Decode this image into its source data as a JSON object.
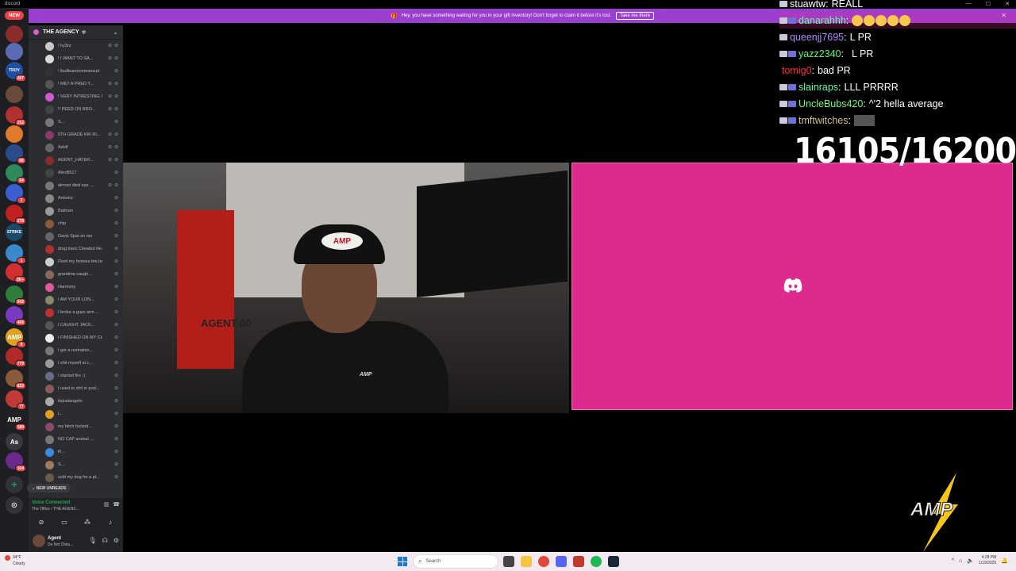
{
  "app": {
    "name": "discord"
  },
  "window_controls": {
    "minimize": "—",
    "maximize": "☐",
    "close": "✕"
  },
  "banner": {
    "text": "Hey, you have something waiting for you in your gift inventory! Don't forget to claim it before it's lost.",
    "button": "Take me there",
    "close": "✕"
  },
  "server_rail": {
    "new_label": "NEW",
    "servers": [
      {
        "badge": "",
        "color": "#8a2c2c",
        "label": ""
      },
      {
        "badge": "",
        "color": "#5b6bb5",
        "label": ""
      },
      {
        "badge": "287",
        "color": "#1d4fa3",
        "label": "TROY"
      },
      {
        "badge": "",
        "color": "#6a4a3a",
        "label": ""
      },
      {
        "badge": "152",
        "color": "#b23030",
        "label": ""
      },
      {
        "badge": "",
        "color": "#e07a2a",
        "label": ""
      },
      {
        "badge": "68",
        "color": "#2a4c8a",
        "label": ""
      },
      {
        "badge": "84",
        "color": "#2e8a5a",
        "label": ""
      },
      {
        "badge": "2",
        "color": "#3a5fd0",
        "label": ""
      },
      {
        "badge": "278",
        "color": "#c02020",
        "label": ""
      },
      {
        "badge": "",
        "color": "#1a4a6a",
        "label": "STRIKE"
      },
      {
        "badge": "1",
        "color": "#3a8acb",
        "label": ""
      },
      {
        "badge": "2K+",
        "color": "#d03030",
        "label": ""
      },
      {
        "badge": "942",
        "color": "#2e7d3a",
        "label": ""
      },
      {
        "badge": "466",
        "color": "#7a3ac0",
        "label": ""
      },
      {
        "badge": "8",
        "color": "#e0a020",
        "label": "AMP"
      },
      {
        "badge": "779",
        "color": "#b02a2a",
        "label": ""
      },
      {
        "badge": "822",
        "color": "#8a5a3a",
        "label": ""
      },
      {
        "badge": "77",
        "color": "#c03a3a",
        "label": ""
      },
      {
        "badge": "180",
        "color": "#222222",
        "label": "AMP"
      },
      {
        "badge": "",
        "color": "#36393f",
        "label": "As"
      },
      {
        "badge": "164",
        "color": "#6a2a8a",
        "label": ""
      }
    ],
    "add_icon": "+",
    "explore_icon": "⊙"
  },
  "sidebar": {
    "server_name": "THE AGENCY",
    "channels": [
      {
        "name": "! hy3rz",
        "color": "#c9c9c9"
      },
      {
        "name": "! I WANT TO SA...",
        "color": "#d9d9d9"
      },
      {
        "name": "! lbulltuanironmansuit",
        "color": "#333333"
      },
      {
        "name": "! MET A PRED Y...",
        "color": "#555555"
      },
      {
        "name": "! VERY INTRESTING ST...",
        "color": "#d05ad0"
      },
      {
        "name": "!! PEED ON BRO...",
        "color": "#444444"
      },
      {
        "name": "S...",
        "color": "#777777"
      },
      {
        "name": "5TH GRADE KIK RI...",
        "color": "#8a3a6a"
      },
      {
        "name": "Adolf",
        "color": "#666666"
      },
      {
        "name": "AGENT_HATER...",
        "color": "#8a2a2a"
      },
      {
        "name": "AlexB617",
        "color": "#444444"
      },
      {
        "name": "almost died eye ...",
        "color": "#777777"
      },
      {
        "name": "Antonio",
        "color": "#888888"
      },
      {
        "name": "Batman",
        "color": "#999999"
      },
      {
        "name": "chip",
        "color": "#8a5a3a"
      },
      {
        "name": "Davis Spat on me",
        "color": "#666666"
      },
      {
        "name": "drag back Cheated Ne...",
        "color": "#b03030"
      },
      {
        "name": "Fked my homies bm,he...",
        "color": "#cccccc"
      },
      {
        "name": "grandma caugh...",
        "color": "#8a6a5a"
      },
      {
        "name": "Harmony",
        "color": "#e05a9a"
      },
      {
        "name": "I AM YOUR LON...",
        "color": "#8a8a6a"
      },
      {
        "name": "I broke a guys arm ...",
        "color": "#c03030"
      },
      {
        "name": "I CAUGHT JACK...",
        "color": "#555555"
      },
      {
        "name": "I FINISHED ON MY CH...",
        "color": "#eeeeee"
      },
      {
        "name": "I got a restrainin...",
        "color": "#777777"
      },
      {
        "name": "I shit myself at c...",
        "color": "#999999"
      },
      {
        "name": "I started fire :)",
        "color": "#6a6a8a"
      },
      {
        "name": "I used to shit in pud...",
        "color": "#8a5a5a"
      },
      {
        "name": "itsjustangelo",
        "color": "#aaaaaa"
      },
      {
        "name": "i...",
        "color": "#e0a020"
      },
      {
        "name": "my bitch fucked...",
        "color": "#8a4a6a"
      },
      {
        "name": "NO CAP animal ...",
        "color": "#777777"
      },
      {
        "name": "R...",
        "color": "#3a8ae0"
      },
      {
        "name": "S...",
        "color": "#a07a5a"
      },
      {
        "name": "sold my dog for a pl...",
        "color": "#6a5a4a"
      }
    ],
    "new_unreads": "NEW UNREADS"
  },
  "voice": {
    "title": "Voice Connected",
    "channel": "The Office / THE AGENC..."
  },
  "user": {
    "name": "Agent",
    "status": "Do Not Distu..."
  },
  "video": {
    "arcade_text": "AGENT 00",
    "cap_text": "AMP",
    "shirt_text": "AMP"
  },
  "counter": "16105/16200",
  "chat": [
    {
      "user": "stuawtw",
      "color": "#ffffff",
      "text": "REALL",
      "badges": 1,
      "emotes": 0,
      "hl": false
    },
    {
      "user": "danarahhh",
      "color": "#5aff9a",
      "text": "",
      "badges": 2,
      "emotes": 5,
      "hl": true
    },
    {
      "user": "queenjj7695",
      "color": "#b08aff",
      "text": "L PR",
      "badges": 1,
      "emotes": 0,
      "hl": false
    },
    {
      "user": "yazz2340",
      "color": "#4aff6a",
      "text": "L PR",
      "badges": 2,
      "emotes": 0,
      "hl": false
    },
    {
      "user": "tomig0",
      "color": "#ff2a2a",
      "text": "bad PR",
      "badges": 0,
      "emotes": 0,
      "hl": false
    },
    {
      "user": "slainraps",
      "color": "#5affb0",
      "text": "LLL PRRRR",
      "badges": 2,
      "emotes": 0,
      "hl": false
    },
    {
      "user": "UncleBubs420",
      "color": "#6aff6a",
      "text": "^'2 hella average",
      "badges": 2,
      "emotes": 0,
      "hl": false
    },
    {
      "user": "tmftwitches",
      "color": "#d6c08a",
      "text": "",
      "badges": 2,
      "emotes": 0,
      "img": true,
      "hl": false
    }
  ],
  "overlay_logo": "AMP",
  "taskbar": {
    "weather_temp": "34°F",
    "weather_desc": "Cloudy",
    "search_placeholder": "Search",
    "time": "4:28 PM",
    "date": "1/19/2025"
  },
  "colors": {
    "banner": "#9b3fd1",
    "pink_tile": "#dc2a8f",
    "sidebar": "#2b2d31",
    "rail": "#1e1f22"
  }
}
